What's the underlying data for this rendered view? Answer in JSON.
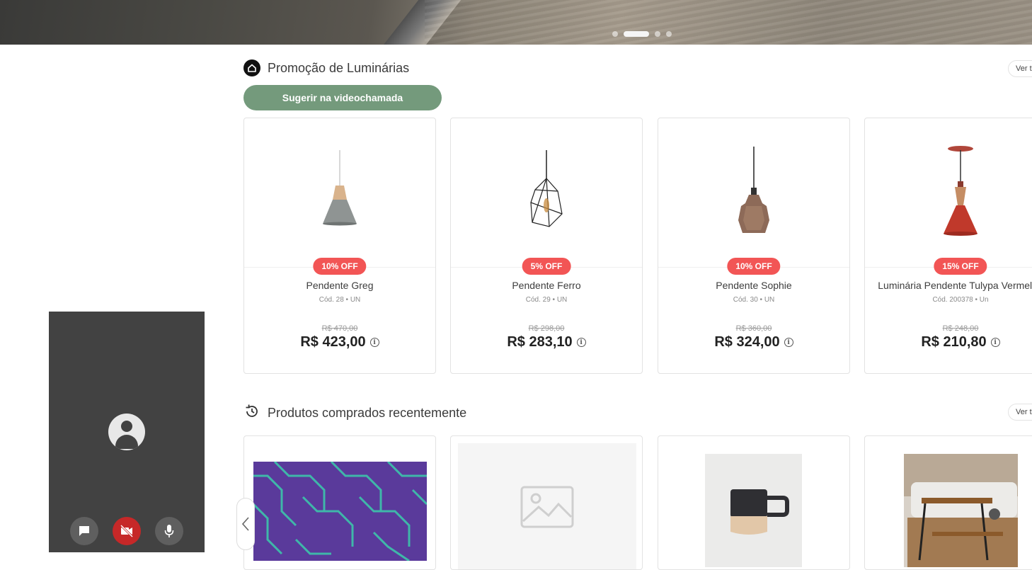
{
  "hero": {
    "active_slide": 2,
    "slides": 4
  },
  "promo_section": {
    "title": "Promoção de Luminárias",
    "see_all": "Ver todos",
    "suggest_button": "Sugerir na videochamada",
    "products": [
      {
        "badge": "10% OFF",
        "name": "Pendente Greg",
        "code": "Cód. 28 • UN",
        "old_price": "R$ 470,00",
        "price": "R$ 423,00"
      },
      {
        "badge": "5% OFF",
        "name": "Pendente Ferro",
        "code": "Cód. 29 • UN",
        "old_price": "R$ 298,00",
        "price": "R$ 283,10"
      },
      {
        "badge": "10% OFF",
        "name": "Pendente Sophie",
        "code": "Cód. 30 • UN",
        "old_price": "R$ 360,00",
        "price": "R$ 324,00"
      },
      {
        "badge": "15% OFF",
        "name": "Luminária Pendente Tulypa Vermelha",
        "code": "Cód. 200378 • Un",
        "old_price": "R$ 248,00",
        "price": "R$ 210,80"
      }
    ]
  },
  "recent_section": {
    "title": "Produtos comprados recentemente",
    "see_all": "Ver todos"
  },
  "colors": {
    "accent_green": "#749a7c",
    "badge_red": "#f25555",
    "video_bg": "#424242",
    "camera_off_red": "#c62828"
  },
  "icons": {
    "section1": "store-icon",
    "section2": "history-icon",
    "info": "info-icon",
    "chat": "chat-icon",
    "camera_off": "camera-off-icon",
    "mic": "mic-icon",
    "avatar": "user-avatar-icon",
    "scroll": "chevron-left-icon"
  }
}
